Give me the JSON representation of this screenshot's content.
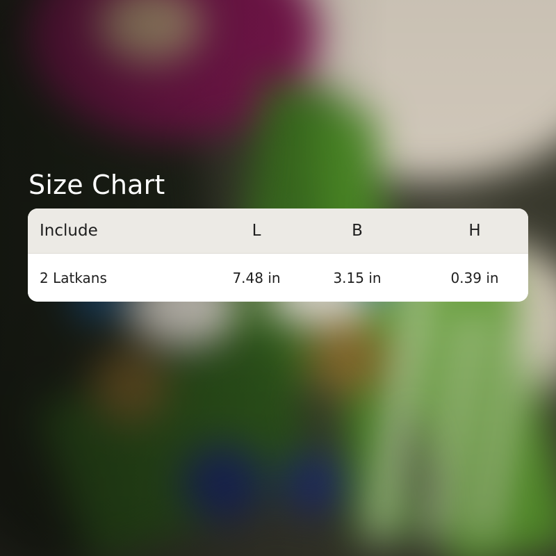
{
  "title": "Size Chart",
  "table": {
    "headers": [
      "Include",
      "L",
      "B",
      "H"
    ],
    "rows": [
      [
        "2 Latkans",
        "7.48 in",
        "3.15 in",
        "0.39 in"
      ]
    ]
  },
  "colors": {
    "title": "#ffffff",
    "header_bg": "#eceae5",
    "row_bg": "#ffffff",
    "text": "#1e1e1e",
    "bg_magenta": "#8a1456",
    "bg_green": "#3f7a1e",
    "bg_cream": "#d9d2c4",
    "bg_blue": "#1c5fa0"
  }
}
